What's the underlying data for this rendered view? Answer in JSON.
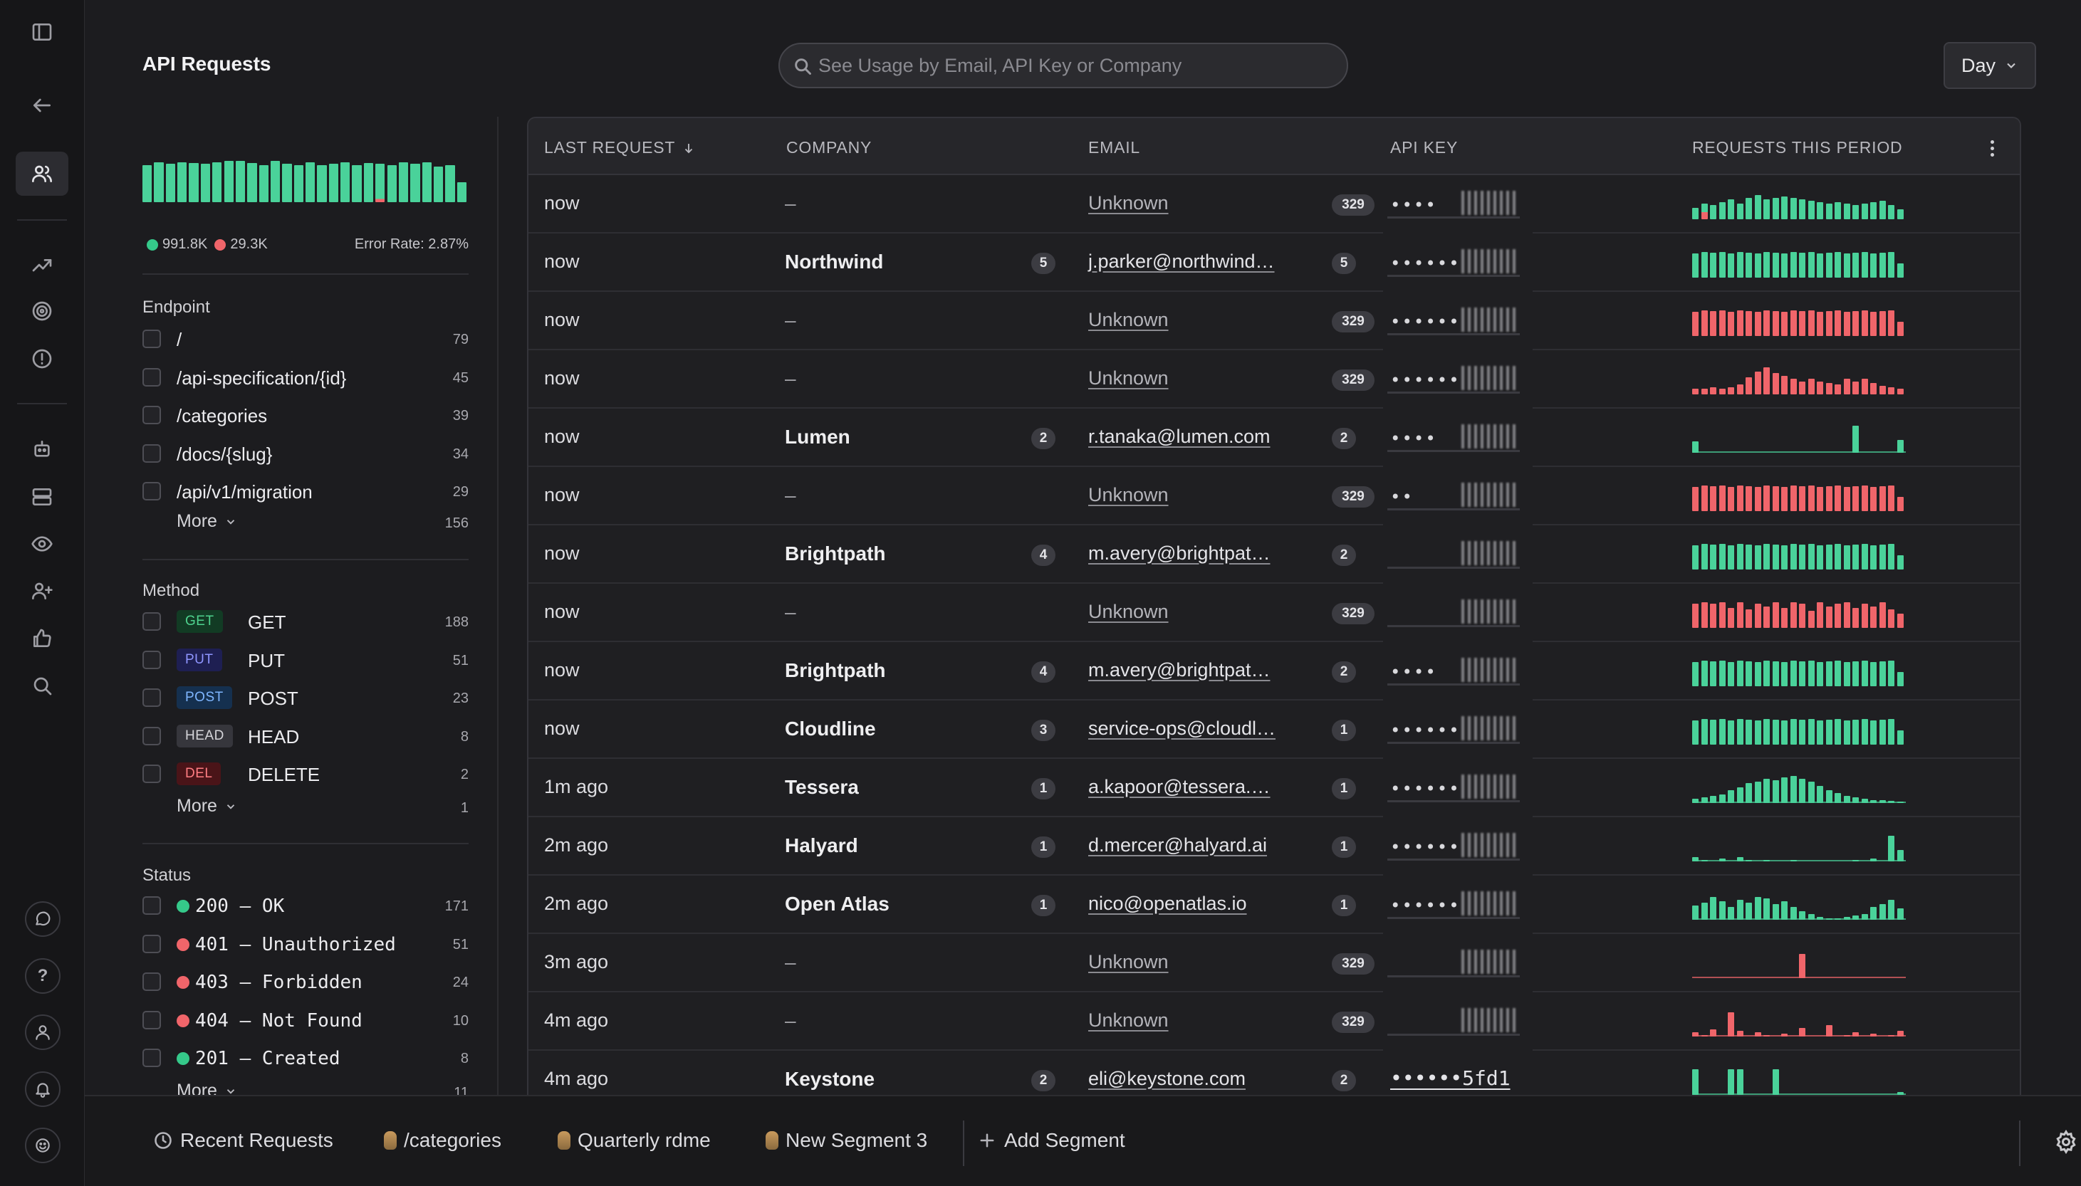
{
  "header": {
    "title": "API Requests",
    "search_placeholder": "See Usage by Email, API Key or Company",
    "period": "Day"
  },
  "summary": {
    "success_count": "991.8K",
    "error_count": "29.3K",
    "error_rate": "Error Rate: 2.87%"
  },
  "filters": {
    "endpoint": {
      "title": "Endpoint",
      "items": [
        {
          "label": "/",
          "count": "79"
        },
        {
          "label": "/api-specification/{id}",
          "count": "45"
        },
        {
          "label": "/categories",
          "count": "39"
        },
        {
          "label": "/docs/{slug}",
          "count": "34"
        },
        {
          "label": "/api/v1/migration",
          "count": "29"
        }
      ],
      "more_label": "More",
      "more_count": "156"
    },
    "method": {
      "title": "Method",
      "items": [
        {
          "badge": "GET",
          "label": "GET",
          "count": "188",
          "badge_bg": "#123b24",
          "badge_fg": "#4fd38f"
        },
        {
          "badge": "PUT",
          "label": "PUT",
          "count": "51",
          "badge_bg": "#1e1f52",
          "badge_fg": "#8f95ff"
        },
        {
          "badge": "POST",
          "label": "POST",
          "count": "23",
          "badge_bg": "#15304f",
          "badge_fg": "#7fb6ff"
        },
        {
          "badge": "HEAD",
          "label": "HEAD",
          "count": "8",
          "badge_bg": "#36363c",
          "badge_fg": "#d6d6da"
        },
        {
          "badge": "DEL",
          "label": "DELETE",
          "count": "2",
          "badge_bg": "#4a1418",
          "badge_fg": "#ff7d82"
        }
      ],
      "more_label": "More",
      "more_count": "1"
    },
    "status": {
      "title": "Status",
      "items": [
        {
          "label": "200 – OK",
          "count": "171",
          "color": "#35c98a"
        },
        {
          "label": "401 – Unauthorized",
          "count": "51",
          "color": "#f0656a"
        },
        {
          "label": "403 – Forbidden",
          "count": "24",
          "color": "#f0656a"
        },
        {
          "label": "404 – Not Found",
          "count": "10",
          "color": "#f0656a"
        },
        {
          "label": "201 – Created",
          "count": "8",
          "color": "#35c98a"
        }
      ],
      "more_label": "More",
      "more_count": "11"
    }
  },
  "table": {
    "columns": {
      "last_request": "LAST REQUEST",
      "company": "COMPANY",
      "email": "EMAIL",
      "api_key": "API KEY",
      "requests": "REQUESTS THIS PERIOD"
    },
    "rows": [
      {
        "time": "now",
        "company": "–",
        "company_count": "",
        "email": "Unknown",
        "email_count": "329",
        "key_mask": "••••",
        "spark": "mixed"
      },
      {
        "time": "now",
        "company": "Northwind",
        "company_count": "5",
        "email": "j.parker@northwind…",
        "email_count": "5",
        "key_mask": "••••••",
        "spark": "green-full"
      },
      {
        "time": "now",
        "company": "–",
        "company_count": "",
        "email": "Unknown",
        "email_count": "329",
        "key_mask": "••••••",
        "spark": "red-full"
      },
      {
        "time": "now",
        "company": "–",
        "company_count": "",
        "email": "Unknown",
        "email_count": "329",
        "key_mask": "••••••",
        "spark": "red-wave"
      },
      {
        "time": "now",
        "company": "Lumen",
        "company_count": "2",
        "email": "r.tanaka@lumen.com",
        "email_count": "2",
        "key_mask": "••••",
        "spark": "green-sparse"
      },
      {
        "time": "now",
        "company": "–",
        "company_count": "",
        "email": "Unknown",
        "email_count": "329",
        "key_mask": "••",
        "spark": "red-full"
      },
      {
        "time": "now",
        "company": "Brightpath",
        "company_count": "4",
        "email": "m.avery@brightpat…",
        "email_count": "2",
        "key_mask": "",
        "spark": "green-full"
      },
      {
        "time": "now",
        "company": "–",
        "company_count": "",
        "email": "Unknown",
        "email_count": "329",
        "key_mask": "",
        "spark": "red-jagged"
      },
      {
        "time": "now",
        "company": "Brightpath",
        "company_count": "4",
        "email": "m.avery@brightpat…",
        "email_count": "2",
        "key_mask": "••••",
        "spark": "green-full"
      },
      {
        "time": "now",
        "company": "Cloudline",
        "company_count": "3",
        "email": "service-ops@cloudl…",
        "email_count": "1",
        "key_mask": "••••••",
        "spark": "green-full"
      },
      {
        "time": "1m ago",
        "company": "Tessera",
        "company_count": "1",
        "email": "a.kapoor@tessera.…",
        "email_count": "1",
        "key_mask": "••••••",
        "spark": "green-hump"
      },
      {
        "time": "2m ago",
        "company": "Halyard",
        "company_count": "1",
        "email": "d.mercer@halyard.ai",
        "email_count": "1",
        "key_mask": "••••••",
        "spark": "green-tail"
      },
      {
        "time": "2m ago",
        "company": "Open Atlas",
        "company_count": "1",
        "email": "nico@openatlas.io",
        "email_count": "1",
        "key_mask": "••••••",
        "spark": "green-wave"
      },
      {
        "time": "3m ago",
        "company": "–",
        "company_count": "",
        "email": "Unknown",
        "email_count": "329",
        "key_mask": "",
        "spark": "red-single"
      },
      {
        "time": "4m ago",
        "company": "–",
        "company_count": "",
        "email": "Unknown",
        "email_count": "329",
        "key_mask": "",
        "spark": "red-scatter"
      },
      {
        "time": "4m ago",
        "company": "Keystone",
        "company_count": "2",
        "email": "eli@keystone.com",
        "email_count": "2",
        "key_mask": "••••••",
        "key_clear": "••••••5fd1",
        "spark": "green-blocks"
      }
    ]
  },
  "segments": [
    {
      "label": "Recent Requests",
      "icon": "clock-icon"
    },
    {
      "label": "/categories",
      "icon": "owl-icon"
    },
    {
      "label": "Quarterly rdme",
      "icon": "owl-icon"
    },
    {
      "label": "New Segment 3",
      "icon": "owl-icon"
    }
  ],
  "add_segment_label": "Add Segment",
  "colors": {
    "success": "#4ad29a",
    "error": "#f0656a",
    "accent_bg": "#1c1c1f"
  }
}
